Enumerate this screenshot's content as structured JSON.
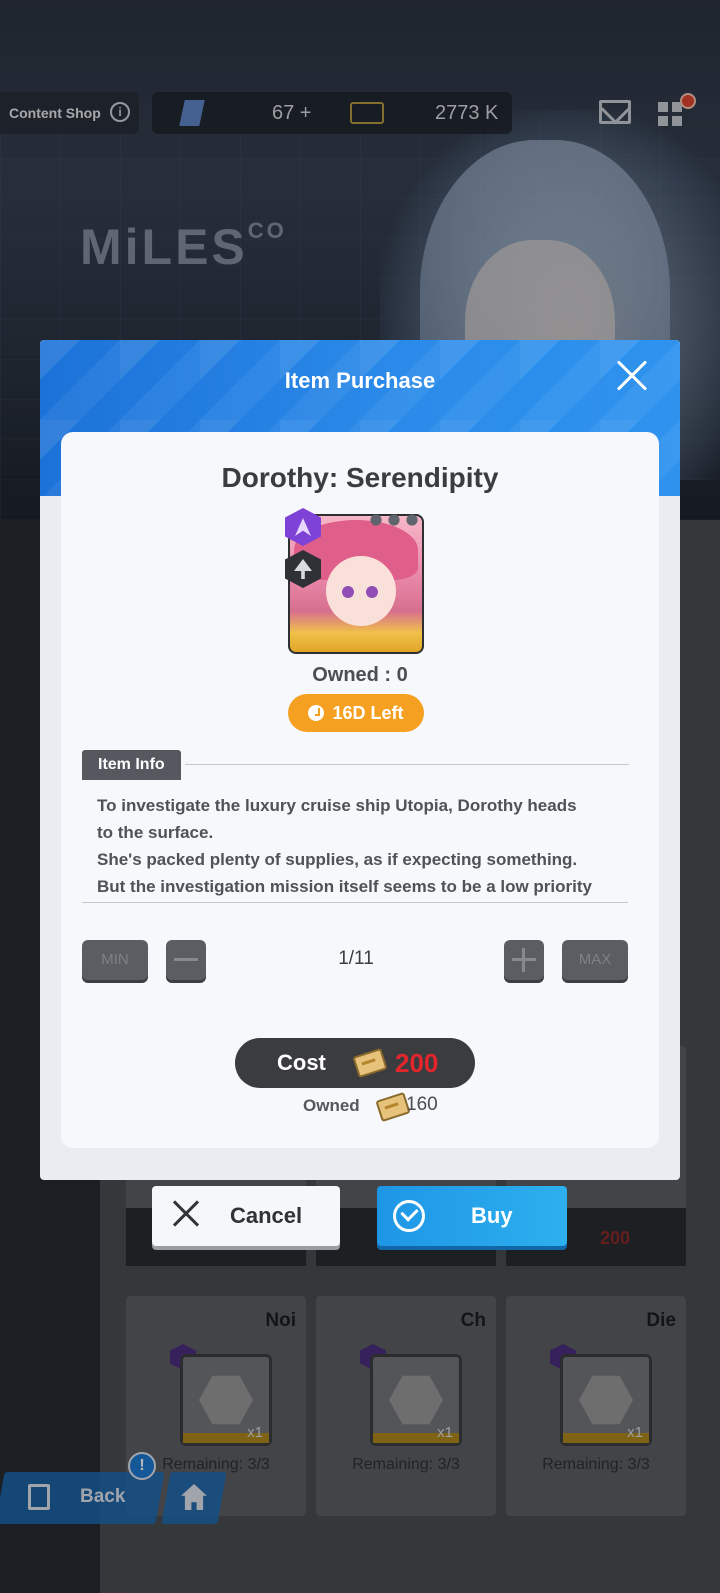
{
  "topbar": {
    "shop_label": "Content Shop",
    "gem_count": "67 +",
    "card_count": "2773 K"
  },
  "background": {
    "logo_text": "MiLES",
    "logo_suffix": "CO",
    "cards": [
      {
        "name": "Noi",
        "remaining": "Remaining: 3/3",
        "qty": "x1"
      },
      {
        "name": "Ch",
        "remaining": "Remaining: 3/3",
        "qty": "x1"
      },
      {
        "name": "Die",
        "remaining": "Remaining: 3/3",
        "qty": "x1"
      }
    ],
    "row_price": "200"
  },
  "modal": {
    "title": "Item Purchase",
    "item_name": "Dorothy: Serendipity",
    "owned_count": "Owned : 0",
    "time_left": "16D Left",
    "info_tab": "Item Info",
    "description": [
      "To investigate the luxury cruise ship Utopia, Dorothy heads",
      "to the surface.",
      "She's packed plenty of supplies, as if expecting something.",
      "But the investigation mission itself seems to be a low priority"
    ],
    "quantity": {
      "min_label": "MIN",
      "max_label": "MAX",
      "value": "1/11"
    },
    "cost": {
      "label": "Cost",
      "value": "200",
      "owned_label": "Owned",
      "owned_value": "160"
    }
  },
  "actions": {
    "cancel_label": "Cancel",
    "buy_label": "Buy"
  },
  "nav": {
    "back_label": "Back",
    "alert_label": "!"
  },
  "colors": {
    "header_blue": "#2a8ae9",
    "time_pill": "#f6a021",
    "cost_red": "#e3262b",
    "buy_blue": "#1e96e6"
  }
}
